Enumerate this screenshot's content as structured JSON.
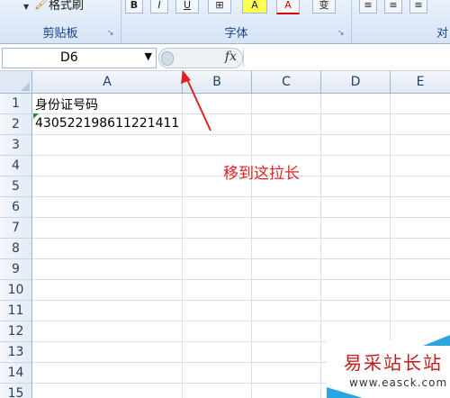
{
  "ribbon": {
    "groups": [
      {
        "label": "剪贴板"
      },
      {
        "label": "字体"
      },
      {
        "label": "对"
      }
    ],
    "format_painter_label": "格式刷",
    "font_buttons": [
      "B",
      "I",
      "U",
      "⊞",
      "A",
      "A",
      "变"
    ],
    "align_buttons": [
      "≡",
      "≡",
      "≡"
    ]
  },
  "formula_bar": {
    "name_box_value": "D6",
    "fx_label": "fx",
    "formula_value": ""
  },
  "sheet": {
    "columns": [
      "A",
      "B",
      "C",
      "D",
      "E"
    ],
    "rows": [
      "1",
      "2",
      "3",
      "4",
      "5",
      "6",
      "7",
      "8",
      "9",
      "10",
      "11",
      "12",
      "13",
      "14",
      "15"
    ],
    "cells": {
      "A1": "身份证号码",
      "A2": "430522198611221411"
    }
  },
  "annotation": {
    "text": "移到这拉长",
    "color": "#e02222"
  },
  "watermark": {
    "title": "易采站长站",
    "url": "www.easck.com"
  }
}
